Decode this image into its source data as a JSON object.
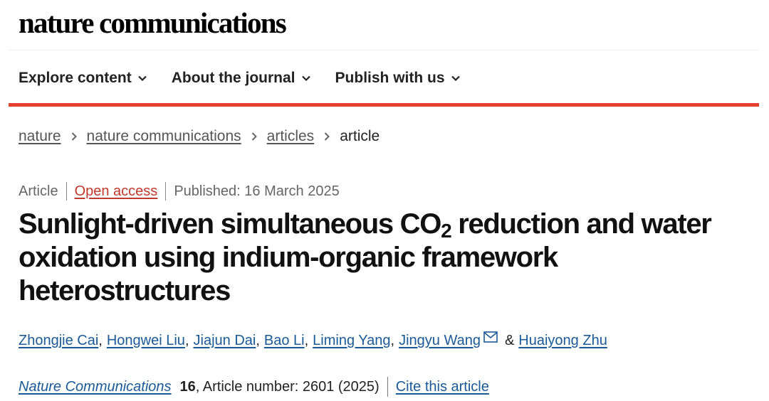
{
  "brand": {
    "logo_text": "nature communications"
  },
  "nav": {
    "items": [
      {
        "label": "Explore content"
      },
      {
        "label": "About the journal"
      },
      {
        "label": "Publish with us"
      }
    ]
  },
  "breadcrumb": {
    "items": [
      "nature",
      "nature communications",
      "articles"
    ],
    "current": "article"
  },
  "meta": {
    "type": "Article",
    "access": "Open access",
    "published": "Published: 16 March 2025"
  },
  "article": {
    "title_part1": "Sunlight-driven simultaneous CO",
    "title_sub": "2",
    "title_part2": " reduction and water oxidation using indium-organic framework heterostructures"
  },
  "authors": {
    "list": [
      "Zhongjie Cai",
      "Hongwei Liu",
      "Jiajun Dai",
      "Bao Li",
      "Liming Yang",
      "Jingyu Wang"
    ],
    "separator": "&",
    "last": "Huaiyong Zhu"
  },
  "citation": {
    "journal": "Nature Communications",
    "volume": "16",
    "rest": ", Article number: 2601 (2025)",
    "cite_label": "Cite this article"
  },
  "colors": {
    "accent_bar": "#e0402c",
    "link": "#1a5a96",
    "open_access": "#c0392b"
  },
  "icons": [
    "chevron-down-icon",
    "chevron-right-icon",
    "mail-icon"
  ]
}
